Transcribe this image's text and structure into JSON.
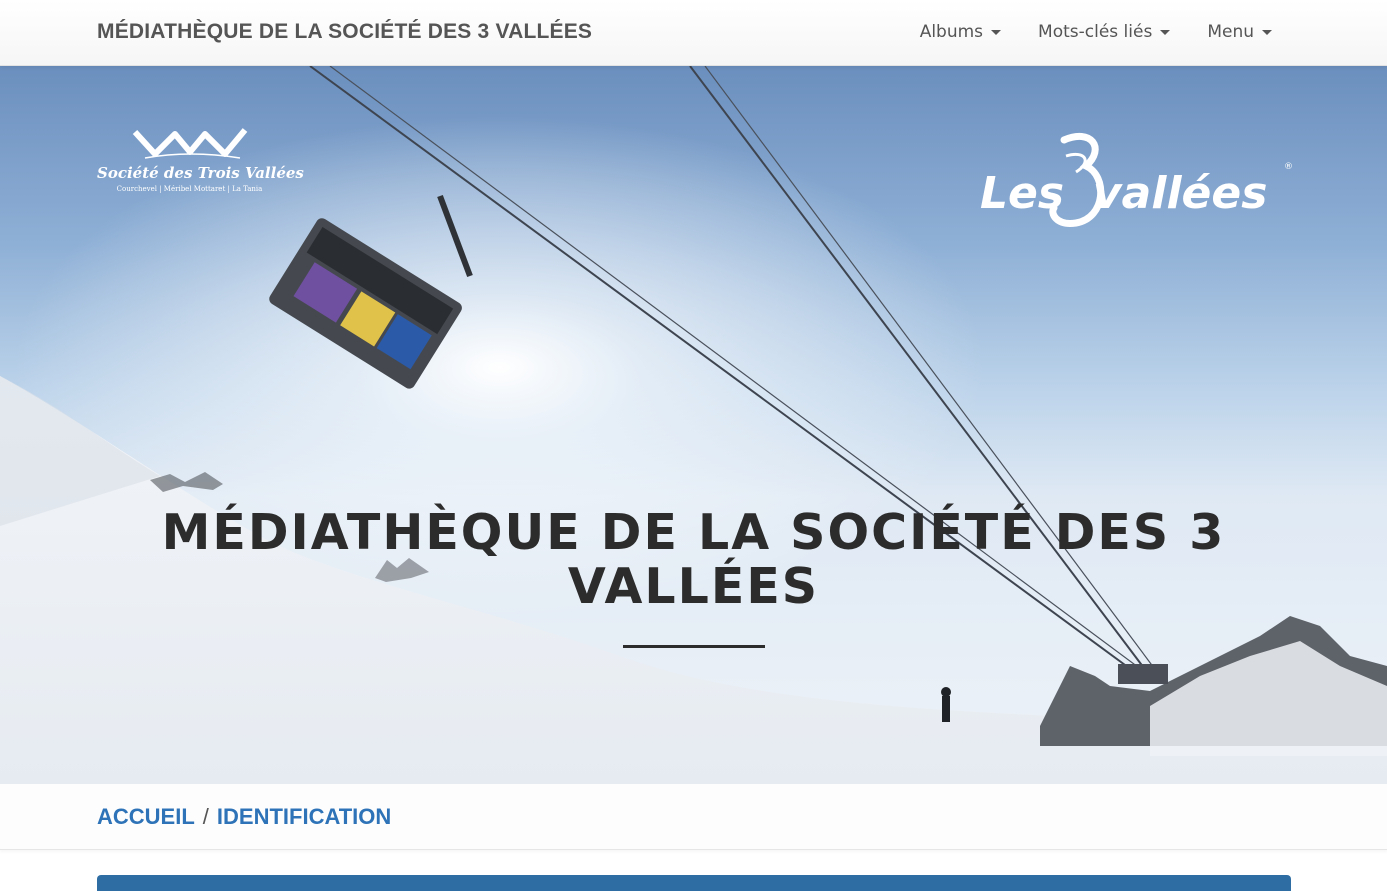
{
  "navbar": {
    "brand": "MÉDIATHÈQUE DE LA SOCIÉTÉ DES 3 VALLÉES",
    "items": [
      {
        "label": "Albums"
      },
      {
        "label": "Mots-clés liés"
      },
      {
        "label": "Menu"
      }
    ]
  },
  "hero": {
    "title": "MÉDIATHÈQUE DE LA SOCIÉTÉ DES 3 VALLÉES",
    "logo_left": {
      "name": "Société des Trois Vallées",
      "sub": "Courchevel | Méribel Mottaret | La Tania"
    },
    "logo_right": {
      "word1": "Les",
      "word2": "vallées",
      "registered": "®"
    }
  },
  "breadcrumb": {
    "home": "ACCUEIL",
    "separator": "/",
    "current": "IDENTIFICATION"
  },
  "colors": {
    "link": "#2e73b7",
    "panel": "#2e6da4"
  }
}
